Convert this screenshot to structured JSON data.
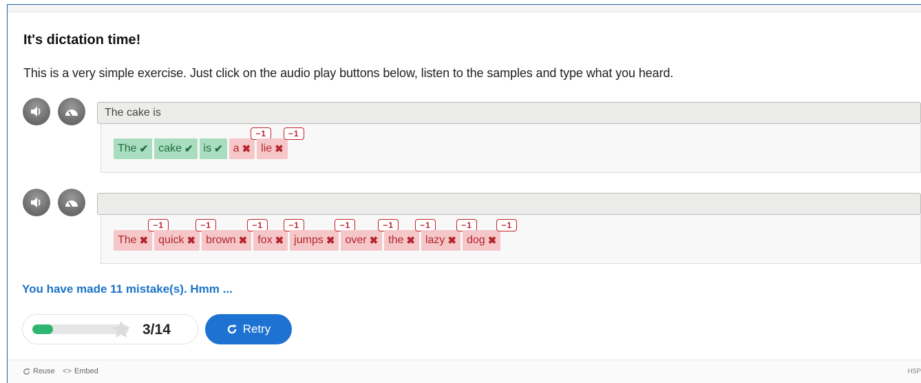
{
  "title": "It's dictation time!",
  "intro": "This is a very simple exercise. Just click on the audio play buttons below, listen to the samples and type what you heard.",
  "sentences": [
    {
      "input_value": "The cake is",
      "words": [
        {
          "text": "The",
          "status": "correct",
          "penalty": ""
        },
        {
          "text": "cake",
          "status": "correct",
          "penalty": ""
        },
        {
          "text": "is",
          "status": "correct",
          "penalty": ""
        },
        {
          "text": "a",
          "status": "wrong",
          "penalty": "−1"
        },
        {
          "text": "lie",
          "status": "wrong",
          "penalty": "−1"
        }
      ]
    },
    {
      "input_value": "",
      "words": [
        {
          "text": "The",
          "status": "wrong",
          "penalty": "−1"
        },
        {
          "text": "quick",
          "status": "wrong",
          "penalty": "−1"
        },
        {
          "text": "brown",
          "status": "wrong",
          "penalty": "−1"
        },
        {
          "text": "fox",
          "status": "wrong",
          "penalty": "−1"
        },
        {
          "text": "jumps",
          "status": "wrong",
          "penalty": "−1"
        },
        {
          "text": "over",
          "status": "wrong",
          "penalty": "−1"
        },
        {
          "text": "the",
          "status": "wrong",
          "penalty": "−1"
        },
        {
          "text": "lazy",
          "status": "wrong",
          "penalty": "−1"
        },
        {
          "text": "dog",
          "status": "wrong",
          "penalty": "−1"
        }
      ]
    }
  ],
  "feedback": "You have made 11 mistake(s). Hmm ...",
  "score": {
    "text": "3/14",
    "fraction": 0.214
  },
  "retry_label": "Retry",
  "footer": {
    "reuse": "Reuse",
    "embed": "Embed",
    "brand": "H5P"
  },
  "colors": {
    "accent": "#1e72d2",
    "correct_bg": "#a8ddbf",
    "wrong_bg": "#f6c7c9",
    "penalty": "#c0232a",
    "progress": "#2fb572"
  },
  "icons": {
    "play": "speaker-icon",
    "slow": "speedometer-icon",
    "correct": "check-icon",
    "wrong": "cross-icon",
    "retry": "refresh-icon",
    "star": "star-icon"
  }
}
